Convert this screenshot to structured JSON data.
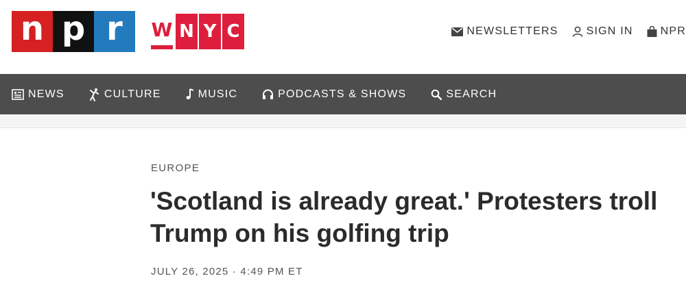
{
  "header": {
    "npr_logo": {
      "letters": [
        "n",
        "p",
        "r"
      ],
      "colors": [
        "#d62021",
        "#111111",
        "#237bbd"
      ]
    },
    "station_logo": {
      "first": "W",
      "boxes": [
        "N",
        "Y",
        "C"
      ],
      "color": "#de1e3d"
    },
    "utility": [
      {
        "icon": "envelope-icon",
        "label": "NEWSLETTERS"
      },
      {
        "icon": "person-icon",
        "label": "SIGN IN"
      },
      {
        "icon": "bag-icon",
        "label": "NPR"
      }
    ]
  },
  "nav": {
    "items": [
      {
        "icon": "news-icon",
        "label": "NEWS"
      },
      {
        "icon": "culture-icon",
        "label": "CULTURE"
      },
      {
        "icon": "music-note-icon",
        "label": "MUSIC"
      },
      {
        "icon": "headphones-icon",
        "label": "PODCASTS & SHOWS"
      },
      {
        "icon": "search-icon",
        "label": "SEARCH"
      }
    ],
    "bg_color": "#4d4d4d"
  },
  "article": {
    "slug": "EUROPE",
    "headline": "'Scotland is already great.' Protesters troll Trump on his golfing trip",
    "date": "JULY 26, 2025",
    "separator": "·",
    "time": "4:49 PM ET"
  }
}
